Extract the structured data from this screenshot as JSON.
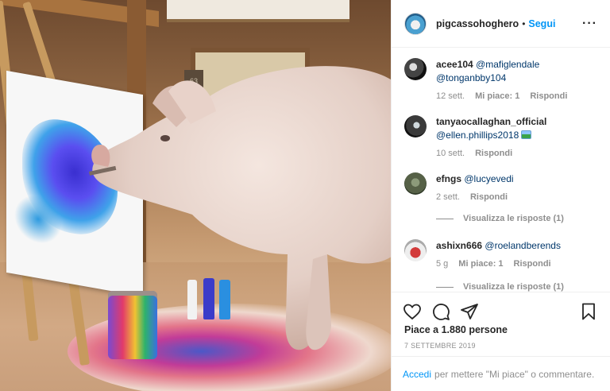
{
  "post": {
    "username": "pigcassohoghero",
    "separator": "•",
    "follow_label": "Segui",
    "more_label": "···"
  },
  "photo": {
    "wall_sign": "63"
  },
  "comments": [
    {
      "user": "acee104",
      "mentions": "@mafiglendale @tonganbby104",
      "time": "12 sett.",
      "likes": "Mi piace: 1",
      "reply": "Rispondi"
    },
    {
      "user": "tanyaocallaghan_official",
      "mentions": "@ellen.phillips2018",
      "time": "10 sett.",
      "reply": "Rispondi"
    },
    {
      "user": "efngs",
      "mentions": "@lucyevedi",
      "time": "2 sett.",
      "reply": "Rispondi",
      "view_replies": "Visualizza le risposte (1)"
    },
    {
      "user": "ashixn666",
      "mentions": "@roelandberends",
      "time": "5 g",
      "likes": "Mi piace: 1",
      "reply": "Rispondi",
      "view_replies": "Visualizza le risposte (1)"
    }
  ],
  "footer": {
    "likes_text": "Piace a 1.880 persone",
    "date": "7 SETTEMBRE 2019",
    "login_link": "Accedi",
    "login_text": "per mettere \"Mi piace\" o commentare."
  },
  "colors": {
    "accent": "#0095f6",
    "mention": "#00376b",
    "muted": "#8e8e8e"
  },
  "icons": [
    "heart-icon",
    "comment-icon",
    "share-icon",
    "bookmark-icon",
    "more-icon"
  ]
}
